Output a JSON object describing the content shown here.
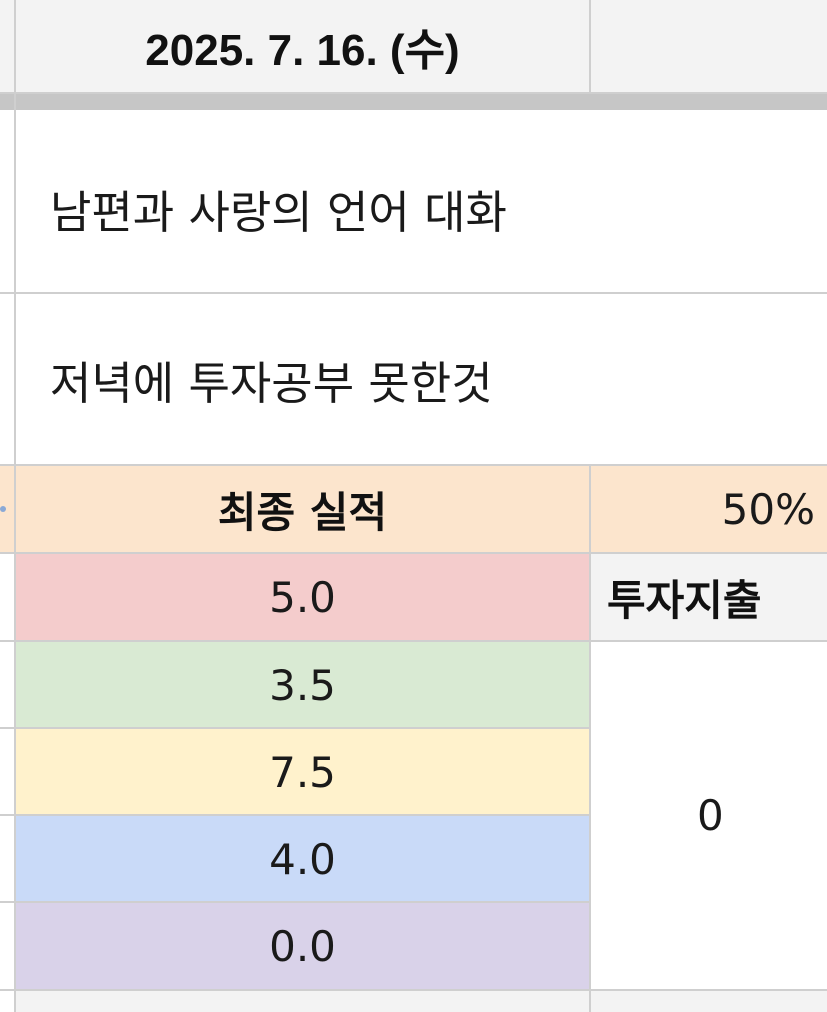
{
  "header": {
    "date": "2025. 7. 16. (수)"
  },
  "memo": {
    "clipped_line": "",
    "line1": "남편과 사랑의 언어 대화",
    "line2": "저녁에 투자공부 못한것"
  },
  "summary": {
    "final_label": "최종 실적",
    "final_percent": "50%",
    "scores": [
      {
        "value": "5.0",
        "color": "#f4cccc"
      },
      {
        "value": "3.5",
        "color": "#d9ead3"
      },
      {
        "value": "7.5",
        "color": "#fff2cc"
      },
      {
        "value": "4.0",
        "color": "#c9daf8"
      },
      {
        "value": "0.0",
        "color": "#d9d2e9"
      }
    ],
    "invest_label": "투자지출",
    "invest_value": "0"
  },
  "colors": {
    "header_bg": "#f3f3f3",
    "final_row_bg": "#fce5cd",
    "freeze_bar": "#c6c6c6",
    "grid": "#cfcfcf"
  }
}
